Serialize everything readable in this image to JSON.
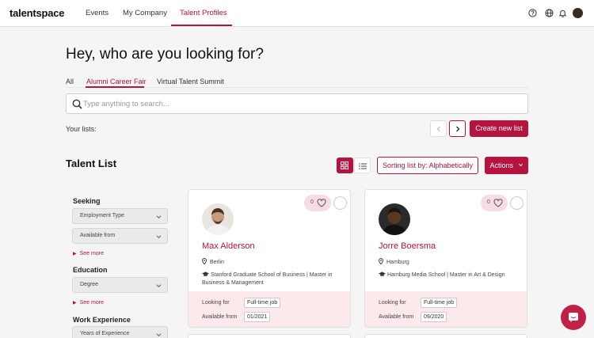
{
  "brand": "talentspace",
  "nav": {
    "items": [
      "Events",
      "My Company",
      "Talent Profiles"
    ],
    "active_index": 2
  },
  "top_icons": [
    "help-icon",
    "globe-icon",
    "bell-icon",
    "user-avatar"
  ],
  "page_title": "Hey, who are you looking for?",
  "tabs": [
    "All",
    "Alumni Career Fair",
    "Virtual Talent Summit"
  ],
  "active_tab": 1,
  "search": {
    "placeholder": "Type anything to search..."
  },
  "lists": {
    "label": "Your lists:",
    "create_label": "Create new list"
  },
  "talent_list": {
    "title": "Talent List",
    "sort_label": "Sorting list by: Alphabetically",
    "actions_label": "Actions",
    "view_mode": "grid"
  },
  "filters": {
    "seeking": {
      "heading": "Seeking",
      "selects": [
        "Employment Type",
        "Available from"
      ],
      "see_more": "See more"
    },
    "education": {
      "heading": "Education",
      "selects": [
        "Degree"
      ],
      "see_more": "See more"
    },
    "work_experience": {
      "heading": "Work Experience",
      "selects": [
        "Years of Experience"
      ]
    }
  },
  "cards": [
    {
      "name": "Max Alderson",
      "likes": "0",
      "location": "Berlin",
      "education": "Stanford Graduate School of Business  |  Master   in Business & Management",
      "looking_for_label": "Looking for",
      "looking_for": "Full-time job",
      "available_label": "Available from",
      "available_from": "01/2021"
    },
    {
      "name": "Jorre Boersma",
      "likes": "0",
      "location": "Hamburg",
      "education": "Hamburg Media School  |  Master   in   Art & Design",
      "looking_for_label": "Looking for",
      "looking_for": "Full-time job",
      "available_label": "Available from",
      "available_from": "09/2020"
    }
  ],
  "colors": {
    "accent": "#b5143f",
    "card_footer": "#fbe9ec",
    "like_pill": "#f7dde3"
  }
}
